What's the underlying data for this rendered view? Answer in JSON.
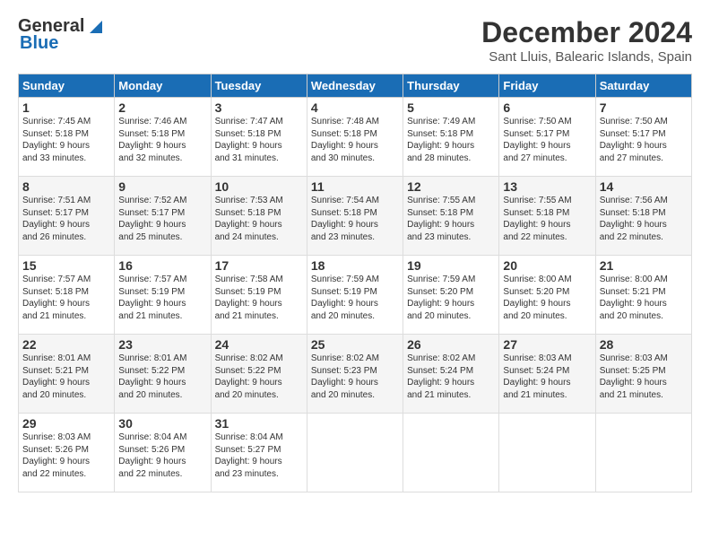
{
  "logo": {
    "part1": "General",
    "part2": "Blue"
  },
  "title": "December 2024",
  "subtitle": "Sant Lluis, Balearic Islands, Spain",
  "headers": [
    "Sunday",
    "Monday",
    "Tuesday",
    "Wednesday",
    "Thursday",
    "Friday",
    "Saturday"
  ],
  "weeks": [
    [
      {
        "day": "1",
        "info": "Sunrise: 7:45 AM\nSunset: 5:18 PM\nDaylight: 9 hours\nand 33 minutes."
      },
      {
        "day": "2",
        "info": "Sunrise: 7:46 AM\nSunset: 5:18 PM\nDaylight: 9 hours\nand 32 minutes."
      },
      {
        "day": "3",
        "info": "Sunrise: 7:47 AM\nSunset: 5:18 PM\nDaylight: 9 hours\nand 31 minutes."
      },
      {
        "day": "4",
        "info": "Sunrise: 7:48 AM\nSunset: 5:18 PM\nDaylight: 9 hours\nand 30 minutes."
      },
      {
        "day": "5",
        "info": "Sunrise: 7:49 AM\nSunset: 5:18 PM\nDaylight: 9 hours\nand 28 minutes."
      },
      {
        "day": "6",
        "info": "Sunrise: 7:50 AM\nSunset: 5:17 PM\nDaylight: 9 hours\nand 27 minutes."
      },
      {
        "day": "7",
        "info": "Sunrise: 7:50 AM\nSunset: 5:17 PM\nDaylight: 9 hours\nand 27 minutes."
      }
    ],
    [
      {
        "day": "8",
        "info": "Sunrise: 7:51 AM\nSunset: 5:17 PM\nDaylight: 9 hours\nand 26 minutes."
      },
      {
        "day": "9",
        "info": "Sunrise: 7:52 AM\nSunset: 5:17 PM\nDaylight: 9 hours\nand 25 minutes."
      },
      {
        "day": "10",
        "info": "Sunrise: 7:53 AM\nSunset: 5:18 PM\nDaylight: 9 hours\nand 24 minutes."
      },
      {
        "day": "11",
        "info": "Sunrise: 7:54 AM\nSunset: 5:18 PM\nDaylight: 9 hours\nand 23 minutes."
      },
      {
        "day": "12",
        "info": "Sunrise: 7:55 AM\nSunset: 5:18 PM\nDaylight: 9 hours\nand 23 minutes."
      },
      {
        "day": "13",
        "info": "Sunrise: 7:55 AM\nSunset: 5:18 PM\nDaylight: 9 hours\nand 22 minutes."
      },
      {
        "day": "14",
        "info": "Sunrise: 7:56 AM\nSunset: 5:18 PM\nDaylight: 9 hours\nand 22 minutes."
      }
    ],
    [
      {
        "day": "15",
        "info": "Sunrise: 7:57 AM\nSunset: 5:18 PM\nDaylight: 9 hours\nand 21 minutes."
      },
      {
        "day": "16",
        "info": "Sunrise: 7:57 AM\nSunset: 5:19 PM\nDaylight: 9 hours\nand 21 minutes."
      },
      {
        "day": "17",
        "info": "Sunrise: 7:58 AM\nSunset: 5:19 PM\nDaylight: 9 hours\nand 21 minutes."
      },
      {
        "day": "18",
        "info": "Sunrise: 7:59 AM\nSunset: 5:19 PM\nDaylight: 9 hours\nand 20 minutes."
      },
      {
        "day": "19",
        "info": "Sunrise: 7:59 AM\nSunset: 5:20 PM\nDaylight: 9 hours\nand 20 minutes."
      },
      {
        "day": "20",
        "info": "Sunrise: 8:00 AM\nSunset: 5:20 PM\nDaylight: 9 hours\nand 20 minutes."
      },
      {
        "day": "21",
        "info": "Sunrise: 8:00 AM\nSunset: 5:21 PM\nDaylight: 9 hours\nand 20 minutes."
      }
    ],
    [
      {
        "day": "22",
        "info": "Sunrise: 8:01 AM\nSunset: 5:21 PM\nDaylight: 9 hours\nand 20 minutes."
      },
      {
        "day": "23",
        "info": "Sunrise: 8:01 AM\nSunset: 5:22 PM\nDaylight: 9 hours\nand 20 minutes."
      },
      {
        "day": "24",
        "info": "Sunrise: 8:02 AM\nSunset: 5:22 PM\nDaylight: 9 hours\nand 20 minutes."
      },
      {
        "day": "25",
        "info": "Sunrise: 8:02 AM\nSunset: 5:23 PM\nDaylight: 9 hours\nand 20 minutes."
      },
      {
        "day": "26",
        "info": "Sunrise: 8:02 AM\nSunset: 5:24 PM\nDaylight: 9 hours\nand 21 minutes."
      },
      {
        "day": "27",
        "info": "Sunrise: 8:03 AM\nSunset: 5:24 PM\nDaylight: 9 hours\nand 21 minutes."
      },
      {
        "day": "28",
        "info": "Sunrise: 8:03 AM\nSunset: 5:25 PM\nDaylight: 9 hours\nand 21 minutes."
      }
    ],
    [
      {
        "day": "29",
        "info": "Sunrise: 8:03 AM\nSunset: 5:26 PM\nDaylight: 9 hours\nand 22 minutes."
      },
      {
        "day": "30",
        "info": "Sunrise: 8:04 AM\nSunset: 5:26 PM\nDaylight: 9 hours\nand 22 minutes."
      },
      {
        "day": "31",
        "info": "Sunrise: 8:04 AM\nSunset: 5:27 PM\nDaylight: 9 hours\nand 23 minutes."
      },
      {
        "day": "",
        "info": ""
      },
      {
        "day": "",
        "info": ""
      },
      {
        "day": "",
        "info": ""
      },
      {
        "day": "",
        "info": ""
      }
    ]
  ]
}
